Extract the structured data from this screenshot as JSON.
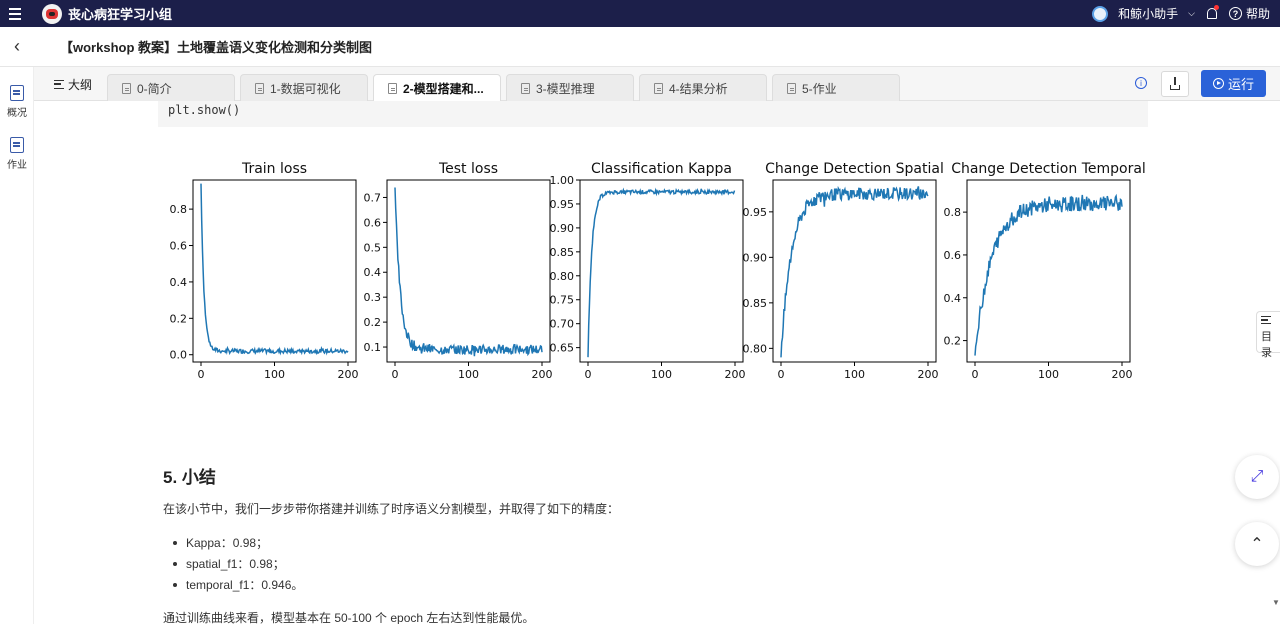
{
  "topbar": {
    "group_name": "丧心病狂学习小组",
    "assistant": "和鲸小助手",
    "help": "帮助"
  },
  "document": {
    "title": "【workshop 教案】土地覆盖语义变化检测和分类制图"
  },
  "left_rail": [
    {
      "label": "概况",
      "icon": "overview-doc-icon"
    },
    {
      "label": "作业",
      "icon": "homework-edit-icon"
    }
  ],
  "tabbar": {
    "outline_label": "大纲",
    "tabs": [
      {
        "label": "0-简介",
        "active": false
      },
      {
        "label": "1-数据可视化",
        "active": false
      },
      {
        "label": "2-模型搭建和...",
        "active": true
      },
      {
        "label": "3-模型推理",
        "active": false
      },
      {
        "label": "4-结果分析",
        "active": false
      },
      {
        "label": "5-作业",
        "active": false
      }
    ],
    "run_label": "运行"
  },
  "code_cell": {
    "code": "plt.show()"
  },
  "chart_data": [
    {
      "type": "line",
      "title": "Train loss",
      "xlim": [
        0,
        200
      ],
      "ylim": [
        -0.04,
        0.96
      ],
      "xticks": [
        0,
        100,
        200
      ],
      "yticks": [
        0.0,
        0.2,
        0.4,
        0.6,
        0.8
      ],
      "ytick_labels": [
        "0.0",
        "0.2",
        "0.4",
        "0.6",
        "0.8"
      ],
      "curve": {
        "start": 0.94,
        "end": 0.02,
        "decay": 4,
        "noise": 0.012
      },
      "color": "#1f77b4"
    },
    {
      "type": "line",
      "title": "Test loss",
      "xlim": [
        0,
        200
      ],
      "ylim": [
        0.04,
        0.77
      ],
      "xticks": [
        0,
        100,
        200
      ],
      "yticks": [
        0.1,
        0.2,
        0.3,
        0.4,
        0.5,
        0.6,
        0.7
      ],
      "ytick_labels": [
        "0.1",
        "0.2",
        "0.3",
        "0.4",
        "0.5",
        "0.6",
        "0.7"
      ],
      "curve": {
        "start": 0.74,
        "end": 0.09,
        "decay": 7,
        "noise": 0.02
      },
      "color": "#1f77b4"
    },
    {
      "type": "line",
      "title": "Classification Kappa",
      "xlim": [
        0,
        200
      ],
      "ylim": [
        0.62,
        1.0
      ],
      "xticks": [
        0,
        100,
        200
      ],
      "yticks": [
        0.65,
        0.7,
        0.75,
        0.8,
        0.85,
        0.9,
        0.95,
        1.0
      ],
      "ytick_labels": [
        "0.65",
        "0.70",
        "0.75",
        "0.80",
        "0.85",
        "0.90",
        "0.95",
        "1.00"
      ],
      "curve": {
        "start": 0.63,
        "end": 0.975,
        "decay": 5,
        "noise": 0.004
      },
      "color": "#1f77b4"
    },
    {
      "type": "line",
      "title": "Change Detection Spatial",
      "xlim": [
        0,
        200
      ],
      "ylim": [
        0.785,
        0.985
      ],
      "xticks": [
        0,
        100,
        200
      ],
      "yticks": [
        0.8,
        0.85,
        0.9,
        0.95
      ],
      "ytick_labels": [
        "0.80",
        "0.85",
        "0.90",
        "0.95"
      ],
      "curve": {
        "start": 0.79,
        "end": 0.97,
        "decay": 14,
        "noise": 0.007
      },
      "color": "#1f77b4"
    },
    {
      "type": "line",
      "title": "Change Detection Temporal",
      "xlim": [
        0,
        200
      ],
      "ylim": [
        0.1,
        0.95
      ],
      "xticks": [
        0,
        100,
        200
      ],
      "yticks": [
        0.2,
        0.4,
        0.6,
        0.8
      ],
      "ytick_labels": [
        "0.2",
        "0.4",
        "0.6",
        "0.8"
      ],
      "curve": {
        "start": 0.13,
        "end": 0.84,
        "decay": 22,
        "noise": 0.035
      },
      "color": "#1f77b4"
    }
  ],
  "summary": {
    "heading": "5. 小结",
    "intro": "在该小节中，我们一步步带你搭建并训练了时序语义分割模型，并取得了如下的精度：",
    "metrics": [
      "Kappa：0.98；",
      "spatial_f1：0.98；",
      "temporal_f1：0.946。"
    ],
    "conclusion": "通过训练曲线来看，模型基本在 50-100 个 epoch 左右达到性能最优。"
  },
  "floating": {
    "toc_label": "目录"
  }
}
